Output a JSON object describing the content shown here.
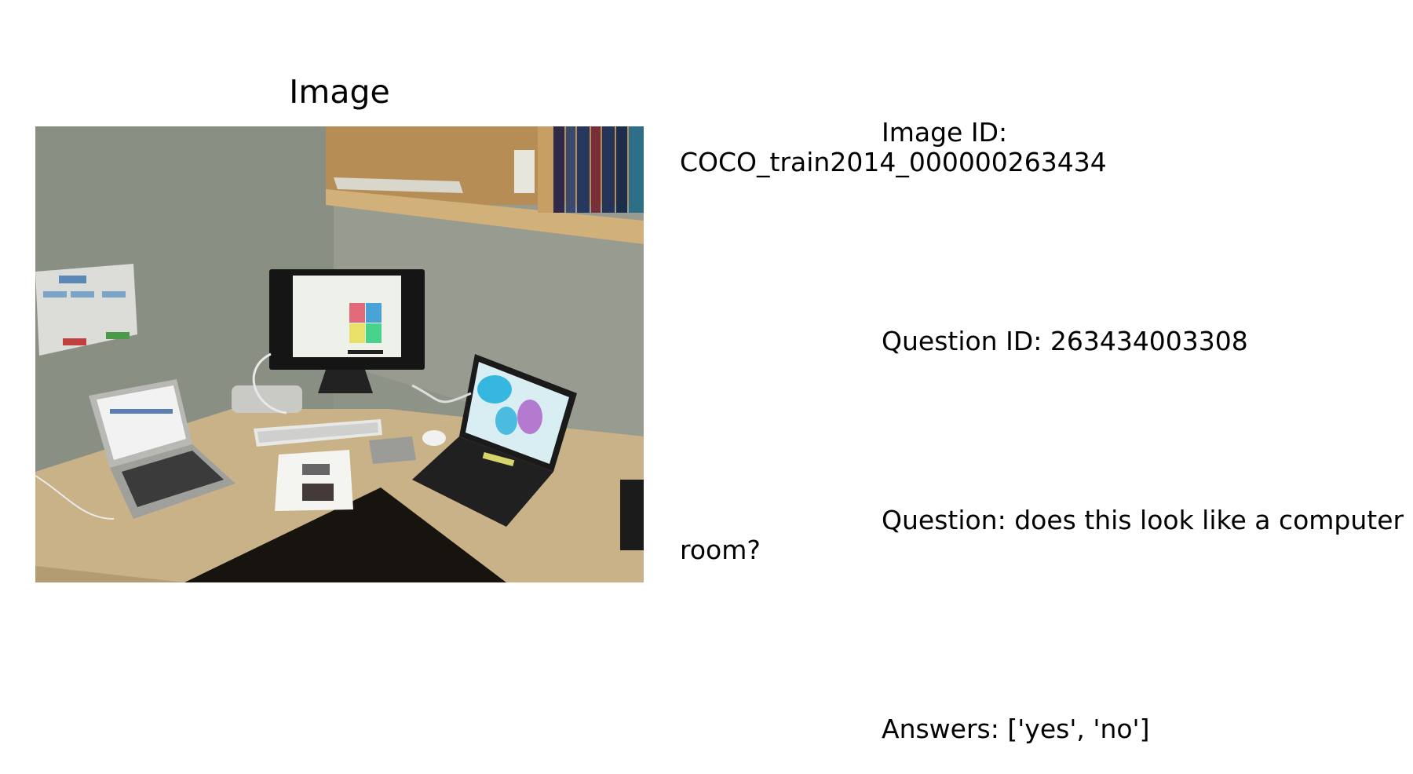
{
  "panel": {
    "title": "Image"
  },
  "meta": {
    "image_id": "Image ID: COCO_train2014_000000263434",
    "question_id": "Question ID: 263434003308",
    "question": "Question: does this look like a computer room?",
    "answers": "Answers: ['yes', 'no']"
  },
  "photo": {
    "subject": "office desk corner with monitor, two laptops, keyboard, shelf with books",
    "colors": {
      "wall": "#8e9387",
      "desk": "#c9b287",
      "shelf": "#c8a36c",
      "screen": "#eef0ea"
    }
  }
}
